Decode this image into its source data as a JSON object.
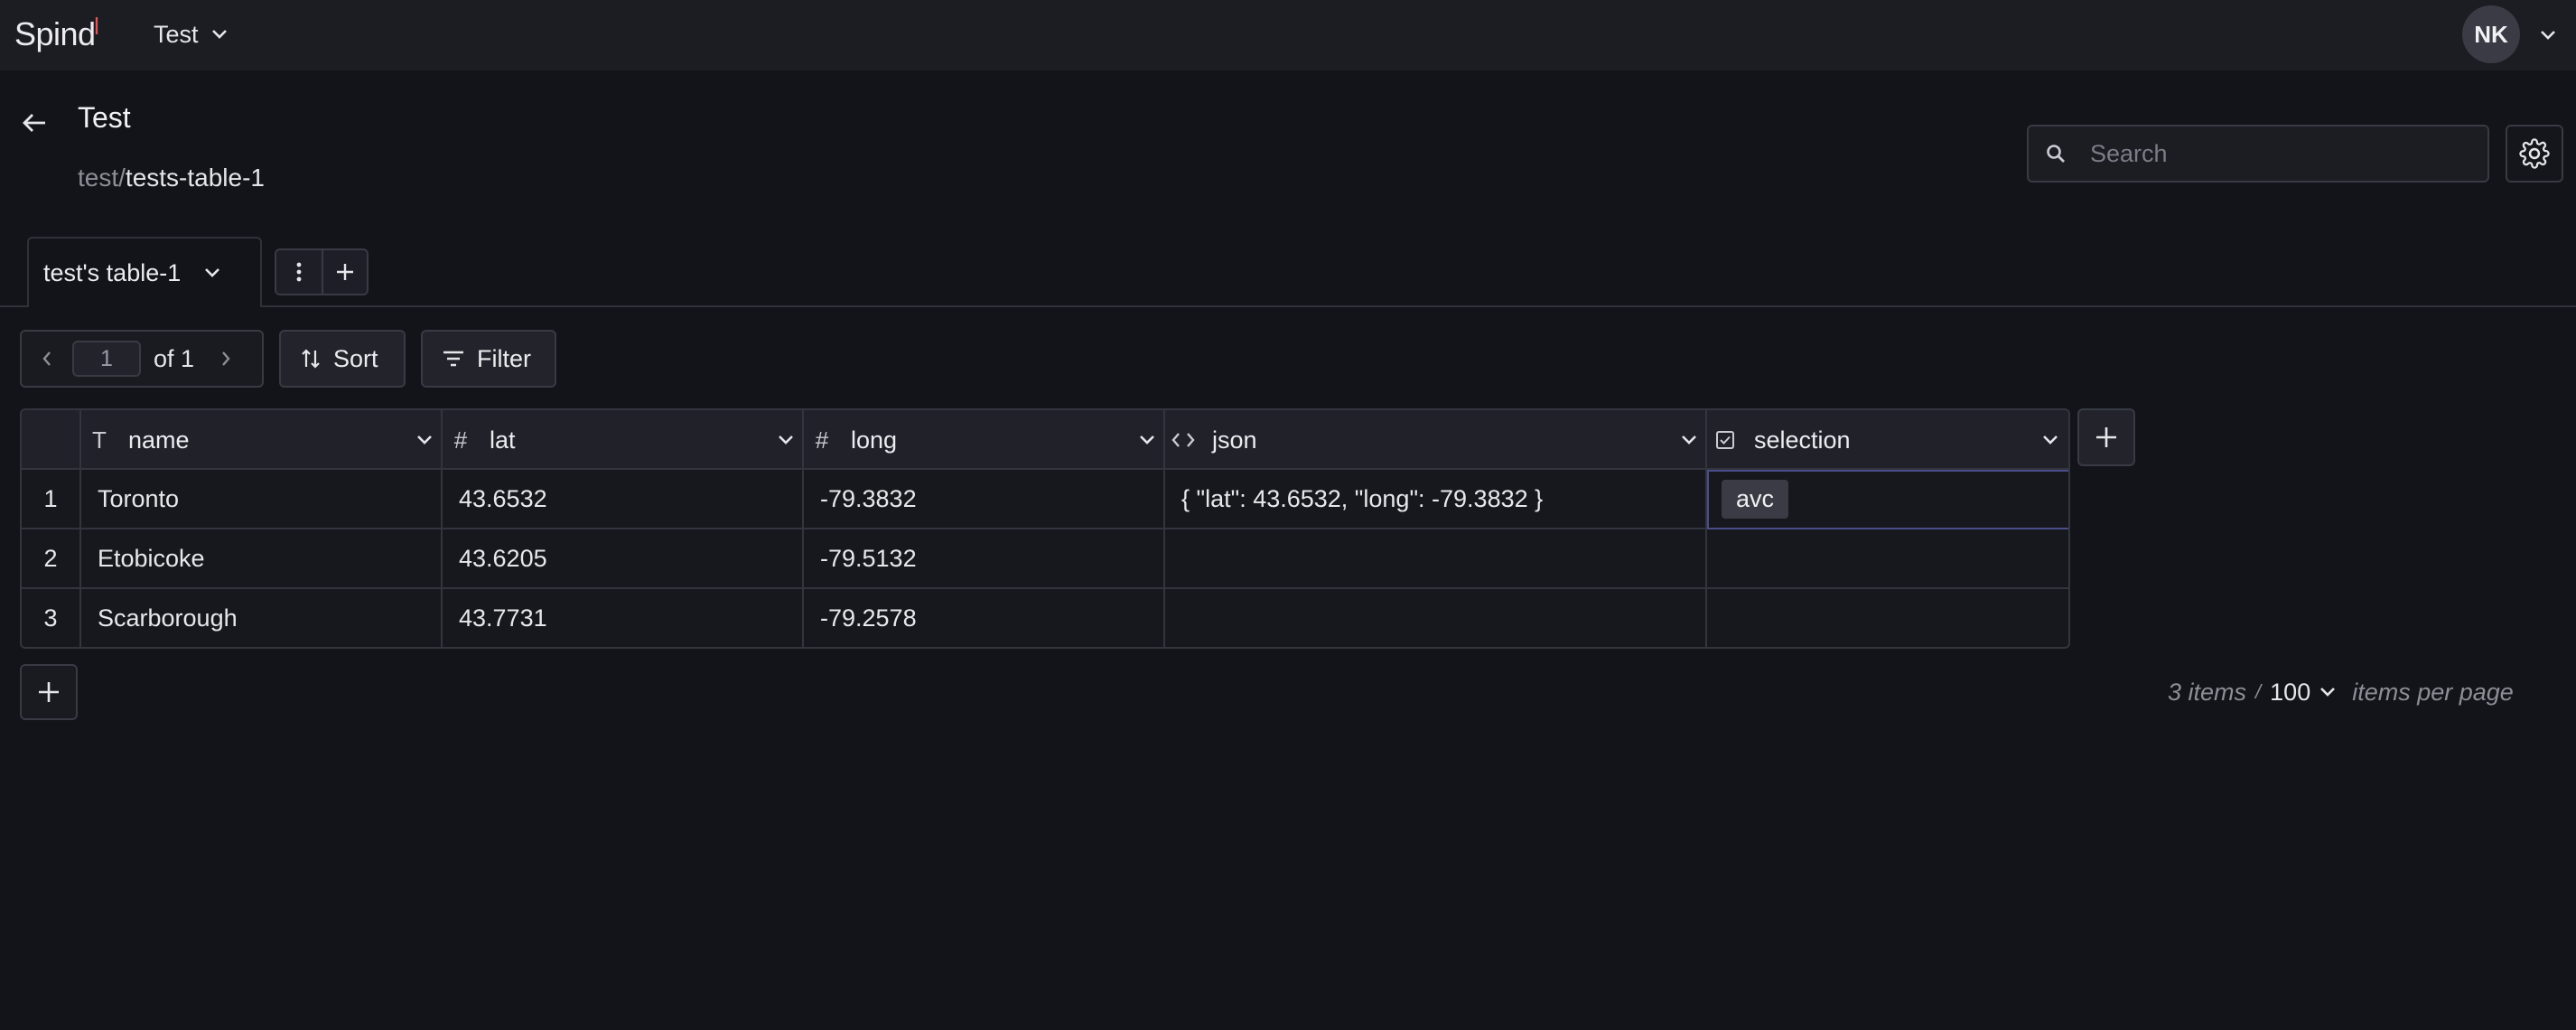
{
  "app": {
    "logo_text": "Spind",
    "workspace": "Test",
    "user_initials": "NK"
  },
  "header": {
    "title": "Test",
    "breadcrumb_parent": "test",
    "breadcrumb_sep": "/",
    "breadcrumb_current": "tests-table-1"
  },
  "search": {
    "placeholder": "Search"
  },
  "tabs": [
    {
      "label": "test's table-1"
    }
  ],
  "toolbar": {
    "page_current": "1",
    "page_of": "of 1",
    "sort_label": "Sort",
    "filter_label": "Filter"
  },
  "table": {
    "columns": [
      {
        "label": "name",
        "type_icon": "T"
      },
      {
        "label": "lat",
        "type_icon": "#"
      },
      {
        "label": "long",
        "type_icon": "#"
      },
      {
        "label": "json",
        "type_icon": "code-icon"
      },
      {
        "label": "selection",
        "type_icon": "checkbox-icon"
      }
    ],
    "rows": [
      {
        "n": "1",
        "name": "Toronto",
        "lat": "43.6532",
        "long": "-79.3832",
        "json": "{ \"lat\": 43.6532, \"long\": -79.3832 }",
        "selection": "avc"
      },
      {
        "n": "2",
        "name": "Etobicoke",
        "lat": "43.6205",
        "long": "-79.5132",
        "json": "",
        "selection": ""
      },
      {
        "n": "3",
        "name": "Scarborough",
        "lat": "43.7731",
        "long": "-79.2578",
        "json": "",
        "selection": ""
      }
    ]
  },
  "footer": {
    "items_count": "3 items",
    "slash": "/",
    "per_page": "100",
    "per_page_label": "items per page"
  },
  "colors": {
    "background": "#131419",
    "topbar": "#1c1d23",
    "border": "#33353e",
    "focus": "#4a4d8a"
  }
}
